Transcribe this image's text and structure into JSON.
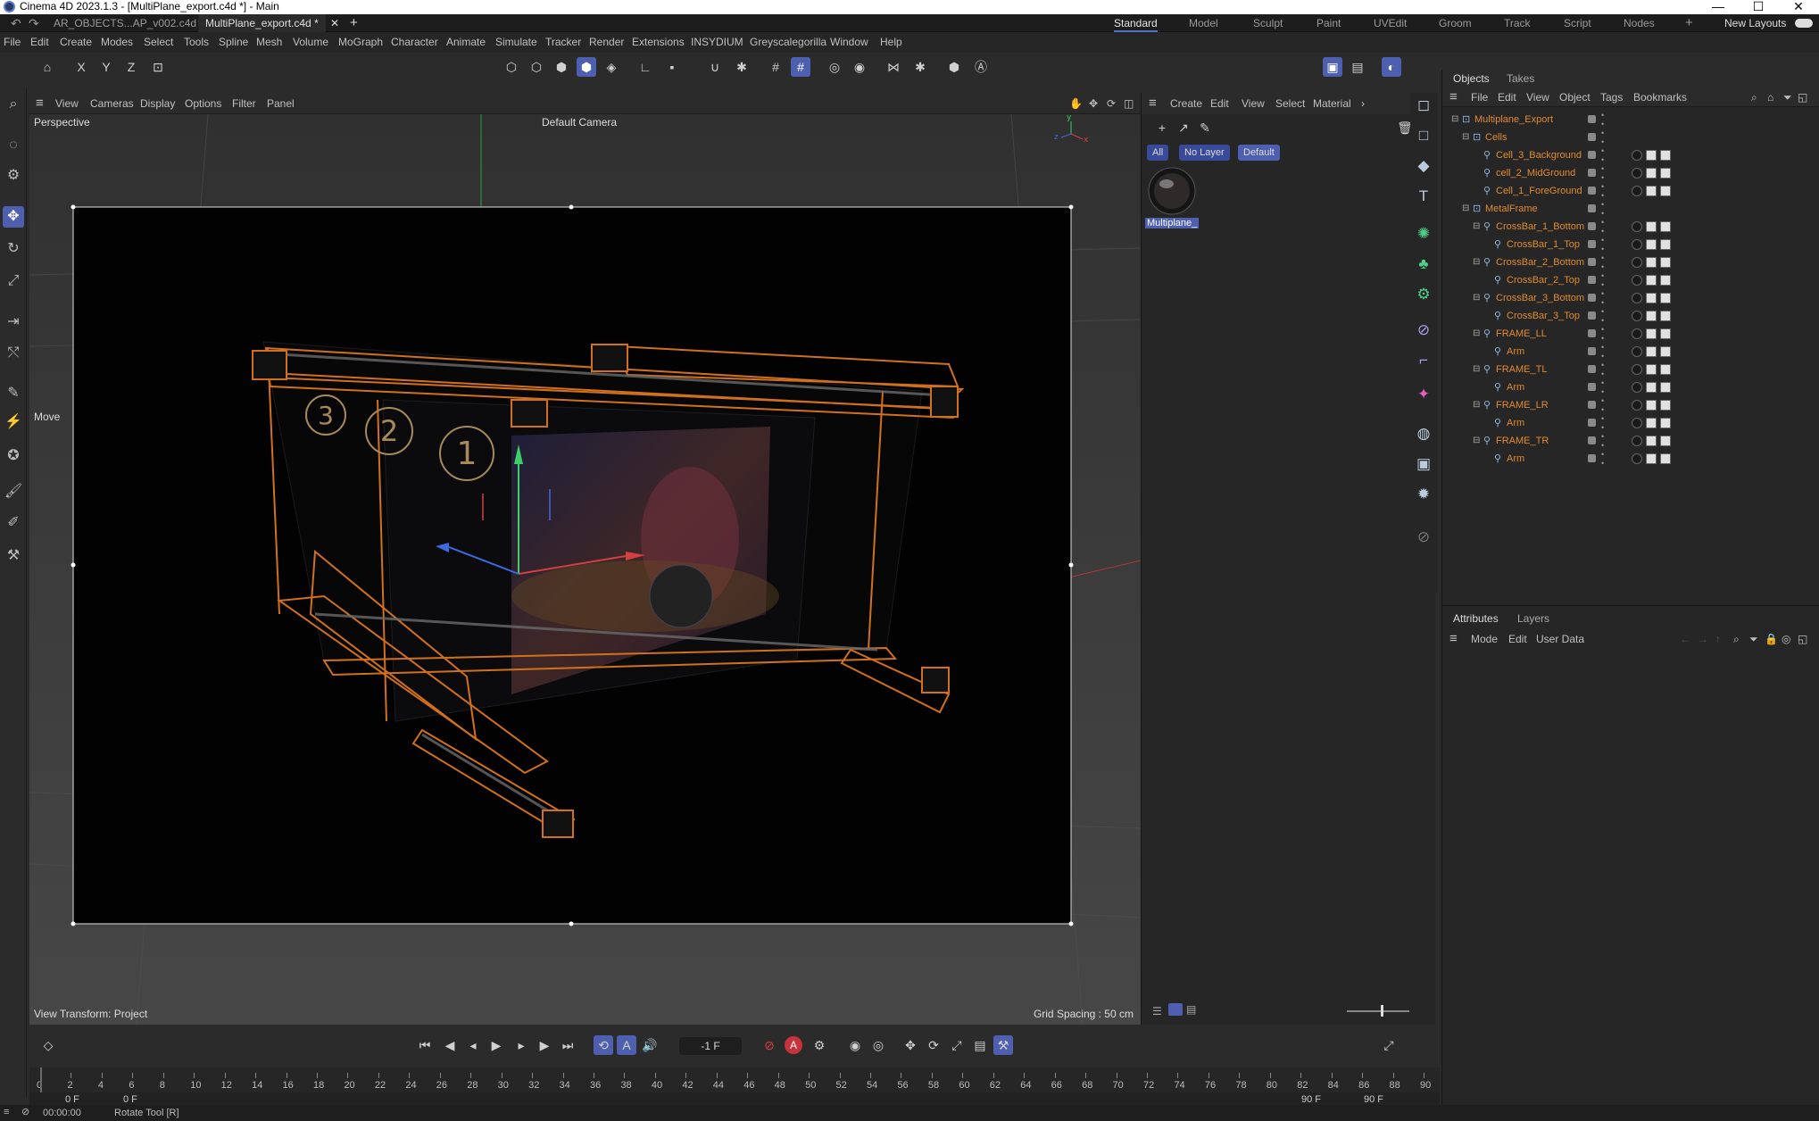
{
  "window": {
    "title": "Cinema 4D 2023.1.3 - [MultiPlane_export.c4d *] - Main",
    "minimize": "—",
    "maximize": "☐",
    "close": "✕"
  },
  "doc_tabs": [
    "AR_OBJECTS...AP_v002.c4d",
    "MultiPlane_export.c4d *"
  ],
  "layouts": [
    "Standard",
    "Model",
    "Sculpt",
    "Paint",
    "UVEdit",
    "Groom",
    "Track",
    "Script",
    "Nodes"
  ],
  "new_layouts": "New Layouts",
  "menu": [
    "File",
    "Edit",
    "Create",
    "Modes",
    "Select",
    "Tools",
    "Spline",
    "Mesh",
    "Volume",
    "MoGraph",
    "Character",
    "Animate",
    "Simulate",
    "Tracker",
    "Render",
    "Extensions",
    "INSYDIUM",
    "Greyscalegorilla",
    "Window",
    "Help"
  ],
  "axis_buttons": [
    "X",
    "Y",
    "Z"
  ],
  "viewport": {
    "menu": [
      "View",
      "Cameras",
      "Display",
      "Options",
      "Filter",
      "Panel"
    ],
    "name": "Perspective",
    "camera": "Default Camera",
    "tool": "Move",
    "view_transform": "View Transform: Project",
    "grid_spacing": "Grid Spacing : 50 cm",
    "cell_numbers": [
      "3",
      "2",
      "1"
    ]
  },
  "material_manager": {
    "menu": [
      "Create",
      "Edit",
      "View",
      "Select",
      "Material"
    ],
    "filters": [
      "All",
      "No Layer",
      "Default"
    ],
    "material_name": "Multiplane_"
  },
  "objects_panel": {
    "tabs": [
      "Objects",
      "Takes"
    ],
    "menu": [
      "File",
      "Edit",
      "View",
      "Object",
      "Tags",
      "Bookmarks"
    ],
    "items": [
      {
        "name": "Multiplane_Export",
        "level": 0,
        "type": "null"
      },
      {
        "name": "Cells",
        "level": 1,
        "type": "null"
      },
      {
        "name": "Cell_3_Background",
        "level": 2,
        "type": "bone"
      },
      {
        "name": "cell_2_MidGround",
        "level": 2,
        "type": "bone"
      },
      {
        "name": "Cell_1_ForeGround",
        "level": 2,
        "type": "bone"
      },
      {
        "name": "MetalFrame",
        "level": 1,
        "type": "null"
      },
      {
        "name": "CrossBar_1_Bottom",
        "level": 2,
        "type": "bone"
      },
      {
        "name": "CrossBar_1_Top",
        "level": 3,
        "type": "bone"
      },
      {
        "name": "CrossBar_2_Bottom",
        "level": 2,
        "type": "bone"
      },
      {
        "name": "CrossBar_2_Top",
        "level": 3,
        "type": "bone"
      },
      {
        "name": "CrossBar_3_Bottom",
        "level": 2,
        "type": "bone"
      },
      {
        "name": "CrossBar_3_Top",
        "level": 3,
        "type": "bone"
      },
      {
        "name": "FRAME_LL",
        "level": 2,
        "type": "bone"
      },
      {
        "name": "Arm",
        "level": 3,
        "type": "bone"
      },
      {
        "name": "FRAME_TL",
        "level": 2,
        "type": "bone"
      },
      {
        "name": "Arm",
        "level": 3,
        "type": "bone"
      },
      {
        "name": "FRAME_LR",
        "level": 2,
        "type": "bone"
      },
      {
        "name": "Arm",
        "level": 3,
        "type": "bone"
      },
      {
        "name": "FRAME_TR",
        "level": 2,
        "type": "bone"
      },
      {
        "name": "Arm",
        "level": 3,
        "type": "bone"
      }
    ]
  },
  "attributes_panel": {
    "tabs": [
      "Attributes",
      "Layers"
    ],
    "menu": [
      "Mode",
      "Edit",
      "User Data"
    ]
  },
  "timeline": {
    "current_frame": "-1 F",
    "ticks": [
      "0",
      "2",
      "4",
      "6",
      "8",
      "10",
      "12",
      "14",
      "16",
      "18",
      "20",
      "22",
      "24",
      "26",
      "28",
      "30",
      "32",
      "34",
      "36",
      "38",
      "40",
      "42",
      "44",
      "46",
      "48",
      "50",
      "52",
      "54",
      "56",
      "58",
      "60",
      "62",
      "64",
      "66",
      "68",
      "70",
      "72",
      "74",
      "76",
      "78",
      "80",
      "82",
      "84",
      "86",
      "88",
      "90"
    ],
    "start": "0 F",
    "start2": "0 F",
    "end": "90 F",
    "end2": "90 F"
  },
  "status": {
    "time": "00:00:00",
    "message": "Rotate Tool [R]"
  },
  "colors": {
    "accent": "#4f5fb0",
    "object_orange": "#e38a30",
    "frame_orange": "#d2701c"
  }
}
